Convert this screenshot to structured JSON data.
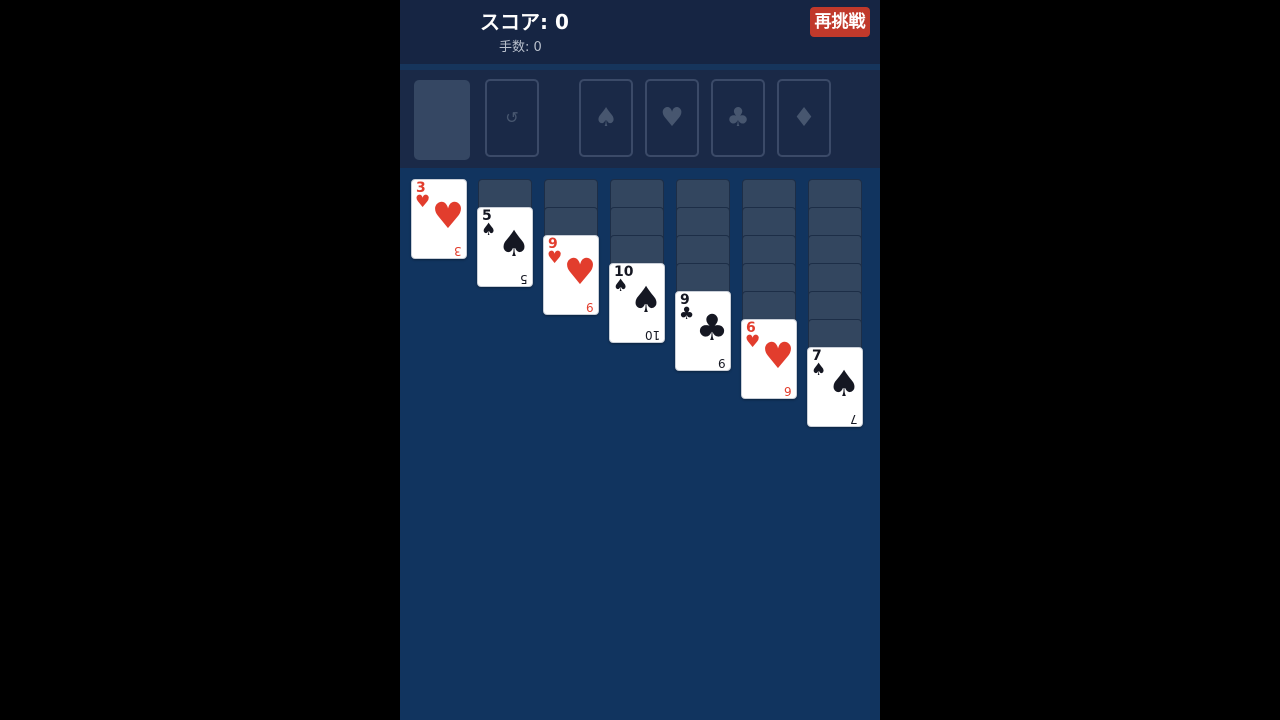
{
  "header": {
    "score_text": "スコア: 0",
    "moves_text": "手数: 0",
    "retry_label": "再挑戦"
  },
  "top": {
    "waste_symbol": "↺",
    "foundations": [
      {
        "suit": "spades",
        "symbol": "♠"
      },
      {
        "suit": "hearts",
        "symbol": "♥"
      },
      {
        "suit": "clubs",
        "symbol": "♣"
      },
      {
        "suit": "diamonds",
        "symbol": "♦"
      }
    ]
  },
  "tableau": [
    {
      "facedown": 0,
      "card": {
        "rank": "3",
        "suit": "hearts",
        "symbol": "♥",
        "color": "red"
      }
    },
    {
      "facedown": 1,
      "card": {
        "rank": "5",
        "suit": "spades",
        "symbol": "♠",
        "color": "black"
      }
    },
    {
      "facedown": 2,
      "card": {
        "rank": "9",
        "suit": "hearts",
        "symbol": "♥",
        "color": "red"
      }
    },
    {
      "facedown": 3,
      "card": {
        "rank": "10",
        "suit": "spades",
        "symbol": "♠",
        "color": "black"
      }
    },
    {
      "facedown": 4,
      "card": {
        "rank": "9",
        "suit": "clubs",
        "symbol": "♣",
        "color": "black"
      }
    },
    {
      "facedown": 5,
      "card": {
        "rank": "6",
        "suit": "hearts",
        "symbol": "♥",
        "color": "red"
      }
    },
    {
      "facedown": 6,
      "card": {
        "rank": "7",
        "suit": "spades",
        "symbol": "♠",
        "color": "black"
      }
    }
  ],
  "colors": {
    "background": "#11345f",
    "header": "#162543",
    "retry_button": "#c0392b",
    "red_suit": "#e23d2d",
    "black_suit": "#151722"
  }
}
